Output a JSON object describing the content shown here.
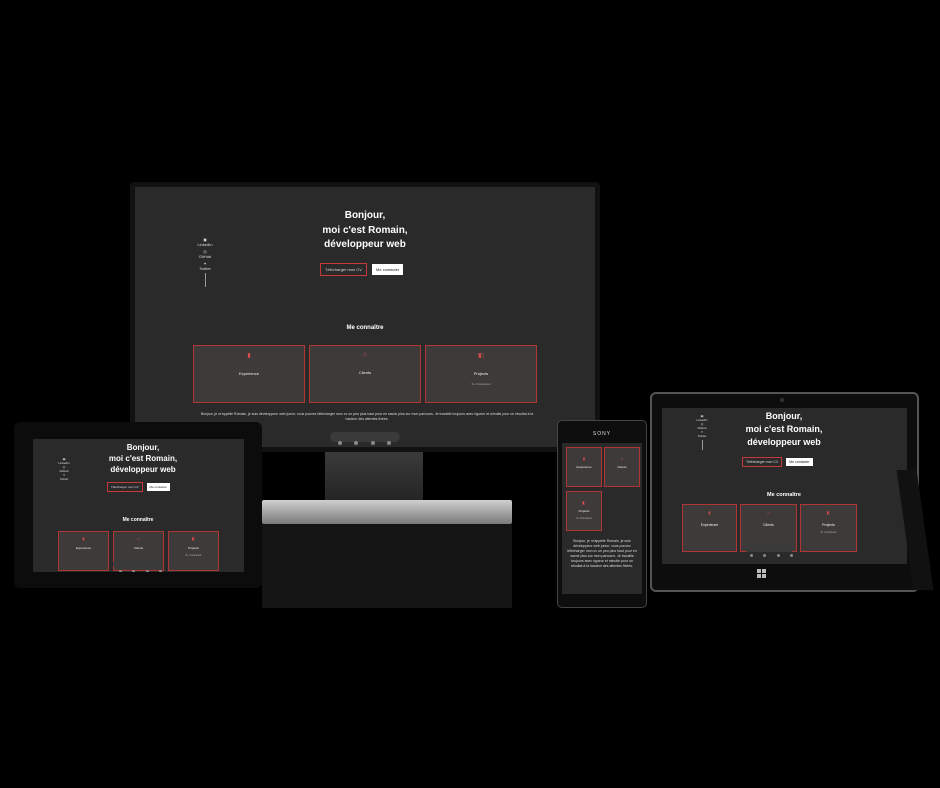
{
  "hero": {
    "line1": "Bonjour,",
    "line2": "moi c'est Romain,",
    "line3": "développeur web"
  },
  "social": {
    "linkedin": "LinkedIn",
    "github": "GitHub",
    "twitter": "Twitter"
  },
  "buttons": {
    "cv": "Télécharger mon CV",
    "contact": "Me contacter"
  },
  "about": {
    "title": "Me connaître",
    "cards": [
      {
        "label": "Experience",
        "icon": "briefcase-icon"
      },
      {
        "label": "Clients",
        "icon": "users-icon"
      },
      {
        "label": "Projects",
        "icon": "folder-icon",
        "sub": "5+ Completed"
      }
    ],
    "bio": "Bonjour, je m'appelle Romain, je suis développeur web junior, vous pouvez télécharger mon cv un peu plus haut pour en savoir plus sur mon parcours. Je travaille toujours avec rigueur et minutie pour un résultat à la hauteur des attentes fixées."
  },
  "devices": {
    "phone_brand": "SONY"
  },
  "colors": {
    "accent": "#c23a3a",
    "screen_bg": "#2a2a2a",
    "card_bg": "#3f3a3a"
  }
}
